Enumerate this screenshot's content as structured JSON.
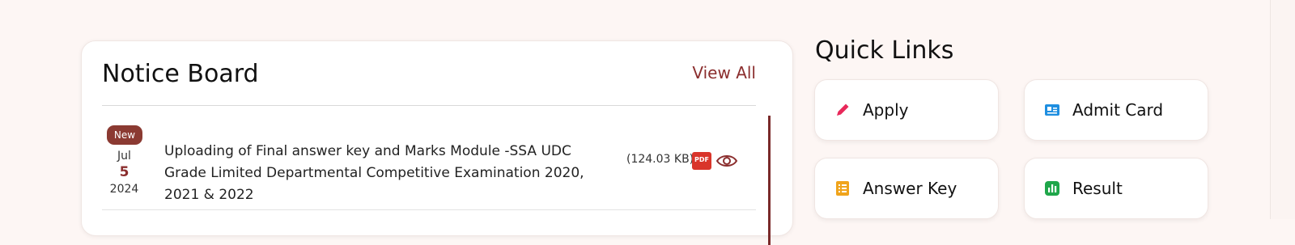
{
  "notice_board": {
    "title": "Notice Board",
    "view_all": "View All",
    "items": [
      {
        "badge": "New",
        "month": "Jul",
        "day": "5",
        "year": "2024",
        "text": "Uploading of Final answer key and Marks Module -SSA UDC Grade Limited Departmental Competitive Examination 2020, 2021 & 2022",
        "file_size": "(124.03 KB)",
        "file_type": "PDF"
      }
    ]
  },
  "quick_links": {
    "title": "Quick Links",
    "items": [
      {
        "label": "Apply",
        "icon": "pencil-icon",
        "color": "#e8285a"
      },
      {
        "label": "Admit Card",
        "icon": "id-card-icon",
        "color": "#1e8ee0"
      },
      {
        "label": "Answer Key",
        "icon": "list-icon",
        "color": "#f0a41c"
      },
      {
        "label": "Result",
        "icon": "bar-chart-icon",
        "color": "#1fa64a"
      }
    ]
  }
}
